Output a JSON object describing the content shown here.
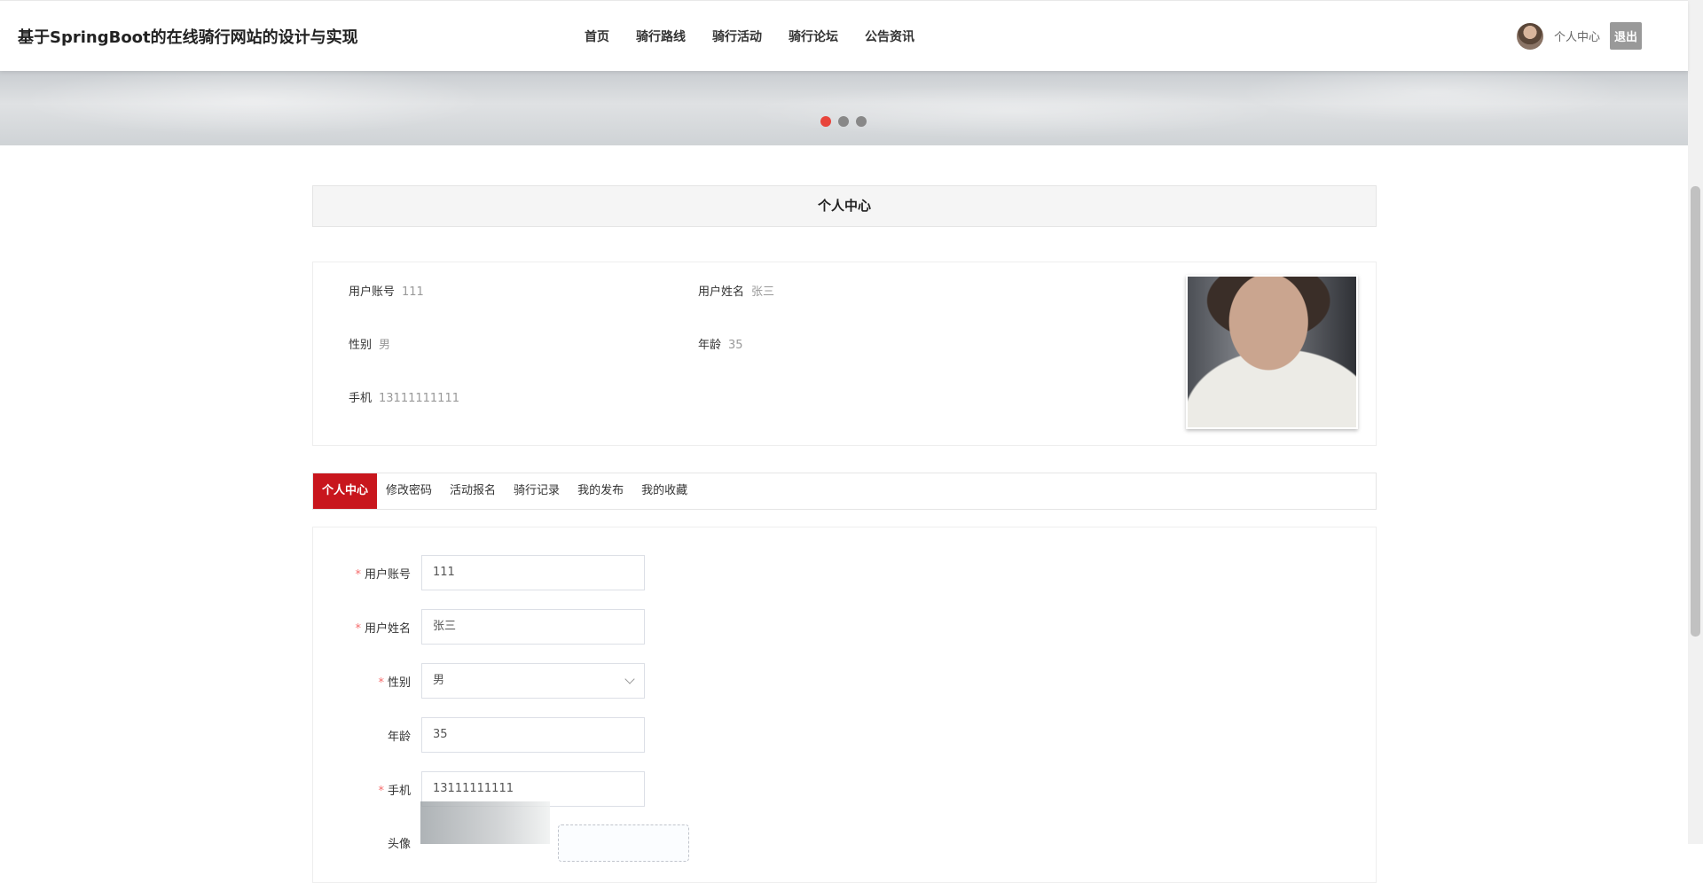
{
  "header": {
    "site_title": "基于SpringBoot的在线骑行网站的设计与实现",
    "nav": [
      "首页",
      "骑行路线",
      "骑行活动",
      "骑行论坛",
      "公告资讯"
    ],
    "user_center": "个人中心",
    "logout": "退出"
  },
  "banner": {
    "dots": 3,
    "active_dot": 1
  },
  "page_title": "个人中心",
  "profile": {
    "account_label": "用户账号",
    "account": "111",
    "name_label": "用户姓名",
    "name": "张三",
    "gender_label": "性别",
    "gender": "男",
    "age_label": "年龄",
    "age": "35",
    "phone_label": "手机",
    "phone": "13111111111"
  },
  "tabs": [
    "个人中心",
    "修改密码",
    "活动报名",
    "骑行记录",
    "我的发布",
    "我的收藏"
  ],
  "active_tab": 0,
  "form": {
    "required_mark": "*",
    "account_label": "用户账号",
    "account": "111",
    "name_label": "用户姓名",
    "name": "张三",
    "gender_label": "性别",
    "gender": "男",
    "age_label": "年龄",
    "age": "35",
    "phone_label": "手机",
    "phone": "13111111111",
    "avatar_label": "头像"
  },
  "colors": {
    "accent": "#c8161d",
    "dot_active": "#e8453c",
    "required": "#f56c6c"
  }
}
